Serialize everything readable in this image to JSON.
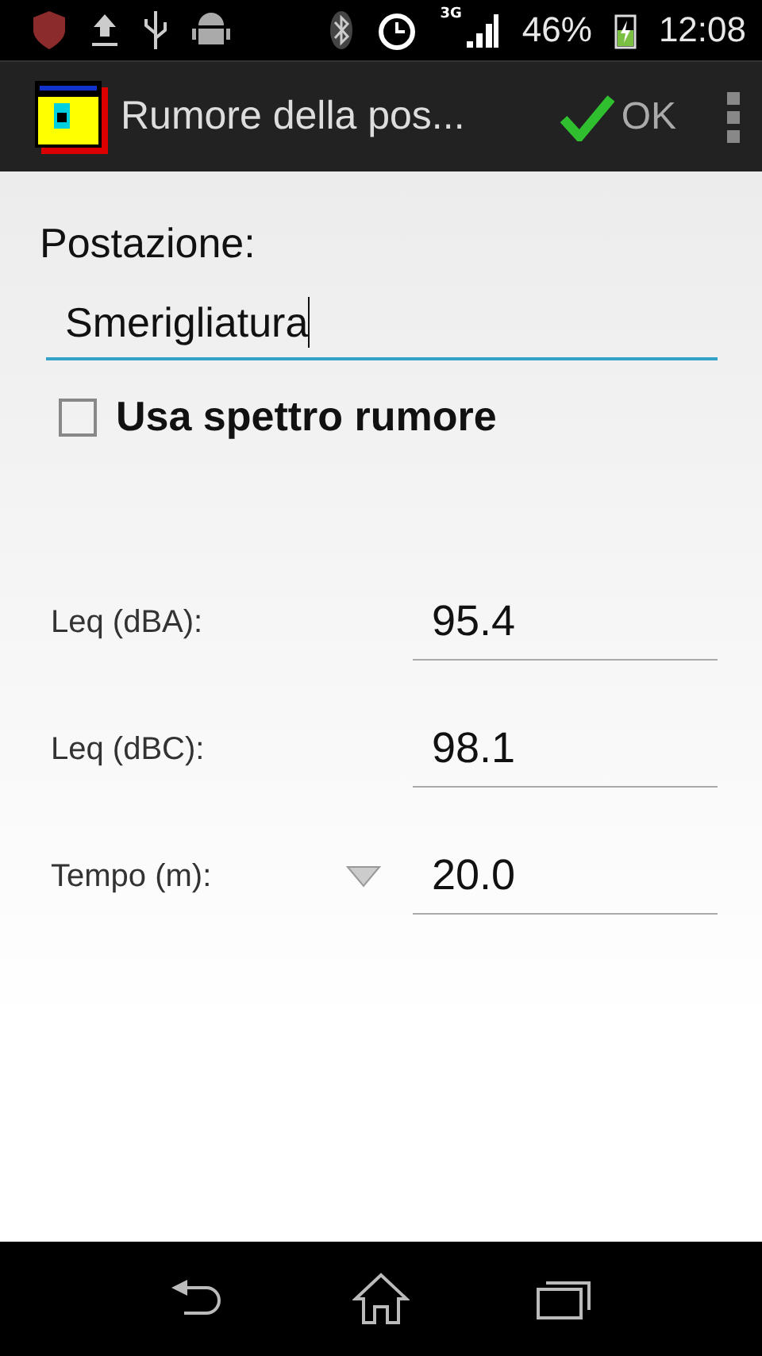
{
  "status_bar": {
    "network": "3G",
    "battery": "46%",
    "time": "12:08"
  },
  "action_bar": {
    "title": "Rumore della pos...",
    "ok": "OK"
  },
  "station": {
    "label": "Postazione:",
    "value": "Smerigliatura",
    "focused": true
  },
  "spectrum": {
    "label": "Usa spettro rumore",
    "checked": false
  },
  "measures": [
    {
      "label": "Leq (dBA):",
      "value": "95.4",
      "kind": "field"
    },
    {
      "label": "Leq (dBC):",
      "value": "98.1",
      "kind": "field"
    },
    {
      "label": "Tempo (m):",
      "value": "20.0",
      "kind": "spinner"
    }
  ]
}
